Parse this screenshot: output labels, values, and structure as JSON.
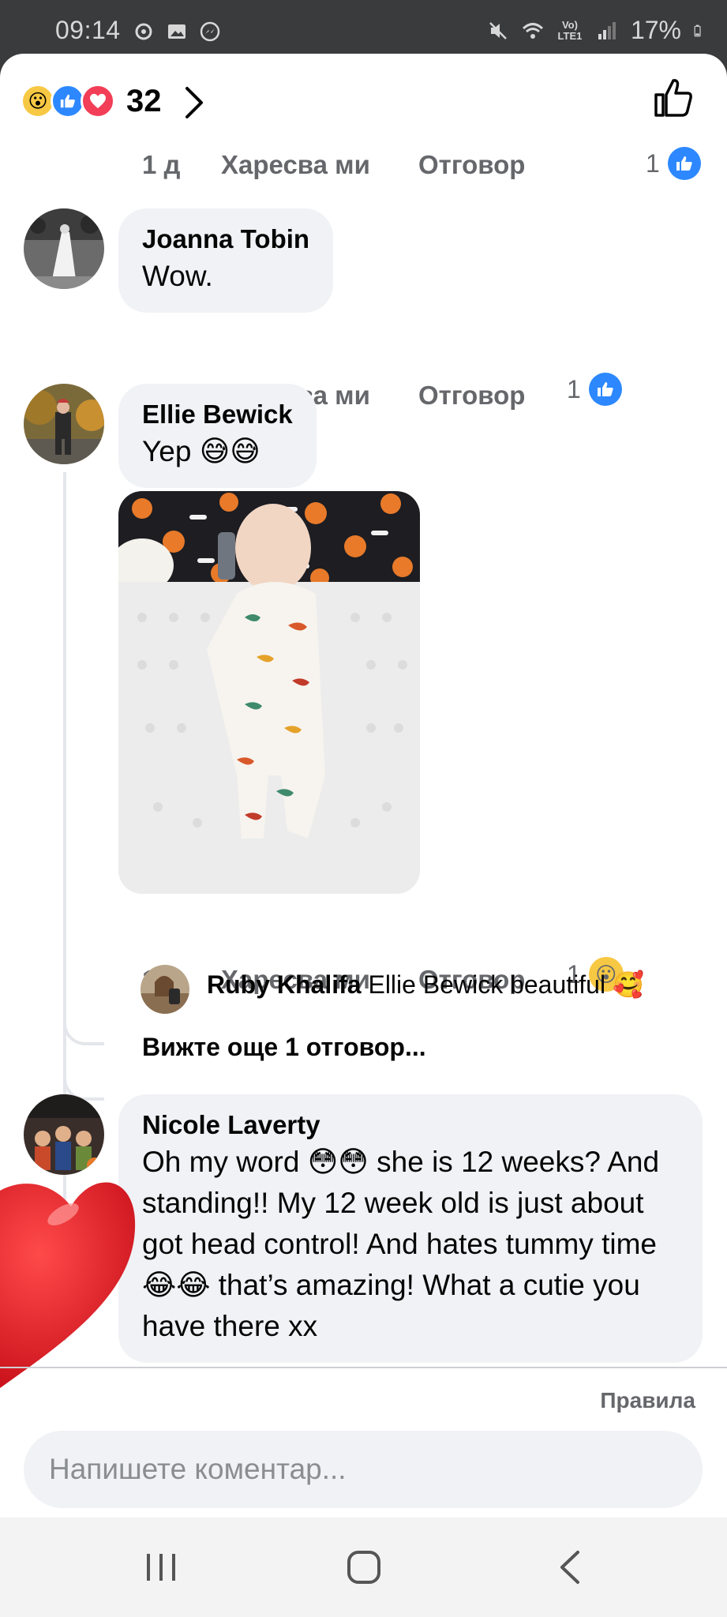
{
  "status_bar": {
    "time": "09:14",
    "battery": "17%",
    "network_label": "Vo) LTE1"
  },
  "reactions_header": {
    "count": "32",
    "icons": [
      "wow-reaction",
      "like-reaction",
      "love-reaction"
    ]
  },
  "comments": [
    {
      "actions": {
        "time": "1 д",
        "like": "Харесва ми",
        "reply": "Отговор",
        "reaction_count": "1"
      }
    },
    {
      "author": "Joanna Tobin",
      "text": "Wow.",
      "actions": {
        "time": "1 д",
        "like": "Харесва ми",
        "reply": "Отговор",
        "reaction_count": "1"
      }
    },
    {
      "author": "Ellie Bewick",
      "text": "Yep 😅😅",
      "actions": {
        "time": "1 д",
        "like": "Харесва ми",
        "reply": "Отговор",
        "reaction_count": "1"
      },
      "reply": {
        "author": "Ruby Khalifa",
        "text": "Ellie Bewick beautiful 🥰"
      },
      "see_more": "Вижте още 1 отговор..."
    },
    {
      "author": "Nicole Laverty",
      "text": "Oh my word 😳😳 she is 12 weeks? And standing!! My 12 week old is just about got head control! And hates tummy time 😂😂 that’s amazing! What a cutie you have there xx"
    }
  ],
  "footer": {
    "rules": "Правила",
    "comment_placeholder": "Напишете коментар..."
  },
  "colors": {
    "like_blue": "#2d88ff",
    "wow_yellow": "#f7c843",
    "love_red": "#f33e58",
    "bubble_gray": "#f0f2f5",
    "meta_gray": "#65676b"
  }
}
